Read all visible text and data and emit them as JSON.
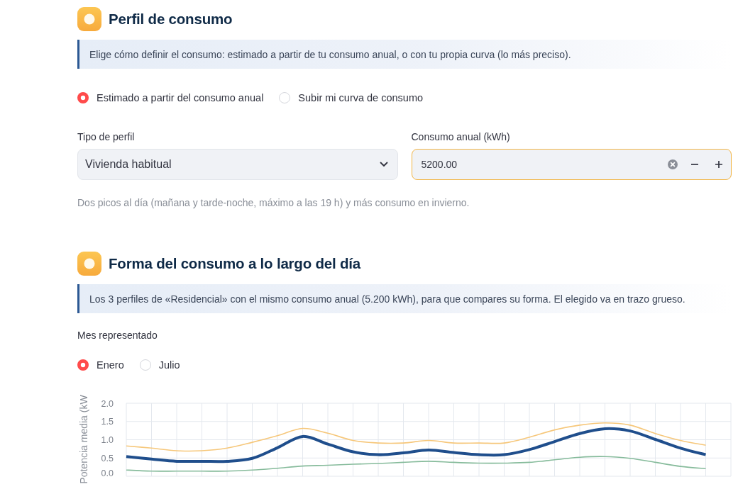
{
  "consumption_profile": {
    "title": "Perfil de consumo",
    "info": "Elige cómo definir el consumo: estimado a partir de tu consumo anual, o con tu propia curva (lo más preciso).",
    "mode_options": [
      {
        "label": "Estimado a partir del consumo anual",
        "selected": true
      },
      {
        "label": "Subir mi curva de consumo",
        "selected": false
      }
    ],
    "profile_type": {
      "label": "Tipo de perfil",
      "value": "Vivienda habitual"
    },
    "annual_consumption": {
      "label": "Consumo anual (kWh)",
      "value": "5200.00",
      "focused": true
    },
    "caption": "Dos picos al día (mañana y tarde-noche, máximo a las 19 h) y más consumo en invierno."
  },
  "daily_shape": {
    "title": "Forma del consumo a lo largo del día",
    "info": "Los 3 perfiles de «Residencial» con el mismo consumo anual (5.200 kWh), para que compares su forma. El elegido va en trazo grueso.",
    "month": {
      "label": "Mes representado",
      "options": [
        {
          "label": "Enero",
          "selected": true
        },
        {
          "label": "Julio",
          "selected": false
        }
      ]
    },
    "profile_curves": [
      {
        "selected": false
      },
      {
        "selected": true
      },
      {
        "selected": false
      }
    ],
    "chart_data": {
      "type": "line",
      "ylabel": "Potencia media (kW",
      "categories": [
        null,
        null,
        null,
        null,
        null,
        null,
        null,
        null,
        null,
        null,
        null,
        null,
        null,
        null,
        null,
        null,
        null,
        null,
        null,
        null,
        null,
        null,
        null,
        null
      ],
      "ylim": [
        0,
        2
      ],
      "yticks": [
        {
          "value": 0,
          "label": "0.0"
        },
        {
          "value": 0.5,
          "label": "0.5"
        },
        {
          "value": 1,
          "label": "1.0"
        },
        {
          "value": 1.5,
          "label": "1.5"
        },
        {
          "value": 2,
          "label": "2.0"
        }
      ],
      "grid": true,
      "series": [
        {
          "color": "#f6c77a",
          "values": [
            0.83,
            0.77,
            0.7,
            0.7,
            0.77,
            0.93,
            1.11,
            1.31,
            1.18,
            0.98,
            0.91,
            0.91,
            0.98,
            0.91,
            0.91,
            0.91,
            1.07,
            1.27,
            1.4,
            1.46,
            1.4,
            1.17,
            0.98,
            0.85
          ]
        },
        {
          "color": "#1f4e8c",
          "values": [
            0.54,
            0.47,
            0.41,
            0.41,
            0.41,
            0.49,
            0.78,
            1.09,
            0.88,
            0.67,
            0.59,
            0.64,
            0.72,
            0.65,
            0.59,
            0.59,
            0.73,
            0.95,
            1.17,
            1.3,
            1.24,
            1.01,
            0.77,
            0.59
          ]
        },
        {
          "color": "#86bb9b",
          "values": [
            0.17,
            0.14,
            0.14,
            0.14,
            0.14,
            0.17,
            0.22,
            0.28,
            0.3,
            0.33,
            0.35,
            0.38,
            0.41,
            0.38,
            0.36,
            0.36,
            0.38,
            0.45,
            0.52,
            0.54,
            0.49,
            0.38,
            0.27,
            0.21
          ]
        }
      ]
    }
  }
}
